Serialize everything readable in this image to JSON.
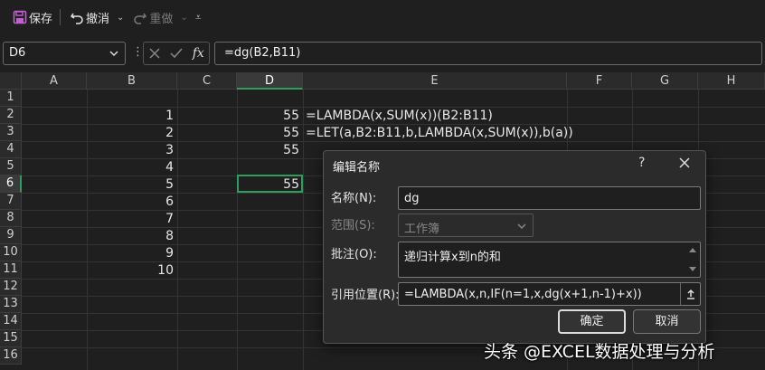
{
  "toolbar": {
    "save_label": "保存",
    "undo_label": "撤消",
    "redo_label": "重做",
    "save_icon": "floppy-disk-icon",
    "undo_icon": "undo-arrow-icon",
    "redo_icon": "redo-arrow-icon",
    "accent": "#c25fd1"
  },
  "formula_bar": {
    "name_box": "D6",
    "fx_label": "fx",
    "formula": "=dg(B2,B11)"
  },
  "grid": {
    "columns": [
      "A",
      "B",
      "C",
      "D",
      "E",
      "F",
      "G",
      "H"
    ],
    "selected_column": "D",
    "rows": [
      "1",
      "2",
      "3",
      "4",
      "5",
      "6",
      "7",
      "8",
      "9",
      "10",
      "11",
      "12",
      "13",
      "14",
      "15",
      "16"
    ],
    "selected_row": "6",
    "selected_cell": "D6",
    "b_values": [
      "1",
      "2",
      "3",
      "4",
      "5",
      "6",
      "7",
      "8",
      "9",
      "10"
    ],
    "d_values": [
      "55",
      "55",
      "55",
      "",
      "55"
    ],
    "e_formulas": [
      "=LAMBDA(x,SUM(x))(B2:B11)",
      "=LET(a,B2:B11,b,LAMBDA(x,SUM(x)),b(a))"
    ],
    "selection_color": "#2e9e5a"
  },
  "dialog": {
    "title": "编辑名称",
    "help": "?",
    "name_label": "名称(N):",
    "name_value": "dg",
    "scope_label": "范围(S):",
    "scope_value": "工作簿",
    "comment_label": "批注(O):",
    "comment_value": "递归计算x到n的和",
    "refers_label": "引用位置(R):",
    "refers_value": "=LAMBDA(x,n,IF(n=1,x,dg(x+1,n-1)+x))",
    "ok_label": "确定",
    "cancel_label": "取消"
  },
  "watermark": "头条 @EXCEL数据处理与分析"
}
